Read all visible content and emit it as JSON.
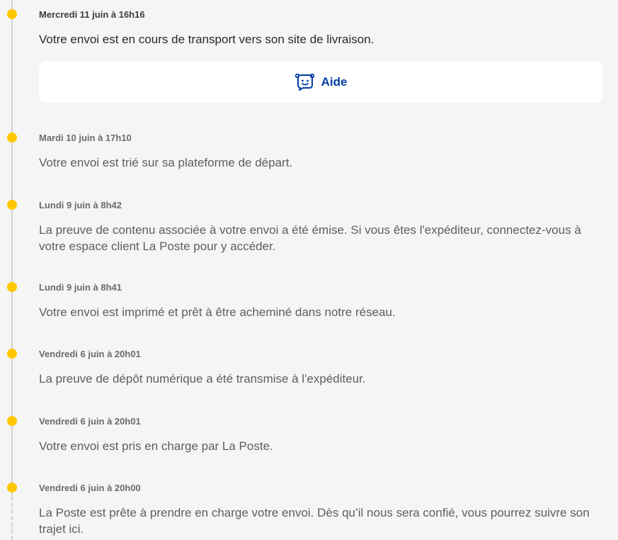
{
  "timeline": {
    "events": [
      {
        "date": "Mercredi 11 juin à 16h16",
        "text": "Votre envoi est en cours de transport vers son site de livraison."
      },
      {
        "date": "Mardi 10 juin à 17h10",
        "text": "Votre envoi est trié sur sa plateforme de départ."
      },
      {
        "date": "Lundi 9 juin à 8h42",
        "text": "La preuve de contenu associée à votre envoi a été émise. Si vous êtes l'expéditeur, connectez-vous à votre espace client La Poste pour y accéder."
      },
      {
        "date": "Lundi 9 juin à 8h41",
        "text": "Votre envoi est imprimé et prêt à être acheminé dans notre réseau."
      },
      {
        "date": "Vendredi 6 juin à 20h01",
        "text": "La preuve de dépôt numérique a été transmise à l'expéditeur."
      },
      {
        "date": "Vendredi 6 juin à 20h01",
        "text": "Votre envoi est pris en charge par La Poste."
      },
      {
        "date": "Vendredi 6 juin à 20h00",
        "text": "La Poste est prête à prendre en charge votre envoi. Dès qu’il nous sera confié, vous pourrez suivre son trajet ici."
      }
    ]
  },
  "help": {
    "label": "Aide",
    "icon": "chat-bot-icon"
  },
  "colors": {
    "dot": "#ffc700",
    "help_text": "#003da5",
    "rail": "#d0d0d0"
  }
}
